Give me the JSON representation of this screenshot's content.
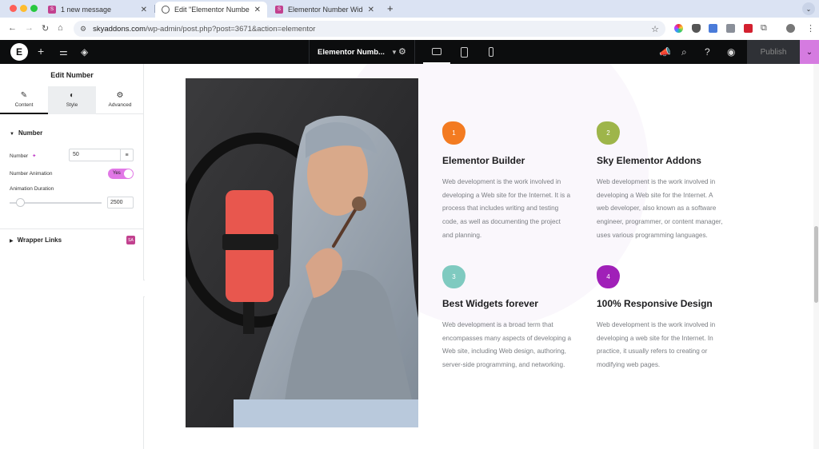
{
  "browser": {
    "tabs": [
      {
        "title": "1 new message",
        "icon": "skyaddons-favicon"
      },
      {
        "title": "Edit \"Elementor Number Widget\"",
        "icon": "globe-icon"
      },
      {
        "title": "Elementor Number Widget - S",
        "icon": "skyaddons-favicon"
      }
    ],
    "url_host": "skyaddons.com",
    "url_path": "/wp-admin/post.php?post=3671&action=elementor"
  },
  "editor": {
    "document_name": "Elementor Numb...",
    "publish_label": "Publish",
    "logo_letter": "E"
  },
  "panel": {
    "title": "Edit Number",
    "tabs": [
      {
        "label": "Content",
        "icon": "pencil-icon"
      },
      {
        "label": "Style",
        "icon": "half-circle-icon"
      },
      {
        "label": "Advanced",
        "icon": "gear-icon"
      }
    ],
    "section_number": "Number",
    "number_label": "Number",
    "number_value": "50",
    "animation_label": "Number Animation",
    "animation_toggle": "Yes",
    "duration_label": "Animation Duration",
    "duration_value": "2500",
    "duration_slider_fraction": 0.12,
    "section_wrapper": "Wrapper Links",
    "sky_badge": "SA"
  },
  "features": [
    {
      "number": "1",
      "color": "#f37b21",
      "title": "Elementor Builder",
      "lines": [
        "Web development is the work involved in",
        "developing a Web site for the Internet. It is a",
        "process that includes writing and testing",
        "code, as well as documenting the project",
        "and planning."
      ]
    },
    {
      "number": "2",
      "color": "#9eb54a",
      "title": "Sky Elementor Addons",
      "lines": [
        "Web development is the work involved in",
        "developing a Web site for the Internet. A",
        "web developer, also known as a software",
        "engineer, programmer, or content manager,",
        "uses various programming languages."
      ]
    },
    {
      "number": "3",
      "color": "#7fcac0",
      "title": "Best Widgets forever",
      "lines": [
        "Web development is a broad term that",
        "encompasses many aspects of developing a",
        "Web site, including Web design, authoring,",
        "server-side programming, and networking."
      ]
    },
    {
      "number": "4",
      "color": "#a020b8",
      "title": "100% Responsive Design",
      "lines": [
        "Web development is the work involved in",
        "developing a web site for the Internet. In",
        "practice, it usually refers to creating or",
        "modifying web pages."
      ]
    }
  ]
}
